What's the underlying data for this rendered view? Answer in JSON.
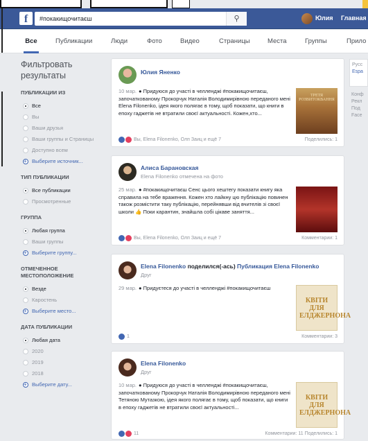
{
  "header": {
    "logo": "f",
    "search_value": "#покакищочитаєш",
    "search_icon": "search-icon",
    "user_name": "Юлия",
    "home_label": "Главная"
  },
  "tabs": [
    "Все",
    "Публикации",
    "Люди",
    "Фото",
    "Видео",
    "Страницы",
    "Места",
    "Группы",
    "Прило"
  ],
  "filters": {
    "title": "Фильтровать результаты",
    "groups": [
      {
        "heading": "ПУБЛИКАЦИИ ИЗ",
        "options": [
          "Все",
          "Вы",
          "Ваши друзья",
          "Ваши группы и Страницы",
          "Доступно всем"
        ],
        "selected": 0,
        "more": "Выберите источник..."
      },
      {
        "heading": "Тип публикации",
        "options": [
          "Все публикации",
          "Просмотренные"
        ],
        "selected": 0,
        "more": ""
      },
      {
        "heading": "ГРУППА",
        "options": [
          "Любая группа",
          "Ваши группы"
        ],
        "selected": 0,
        "more": "Выберите группу..."
      },
      {
        "heading": "ОТМЕЧЕННОЕ МЕСТОПОЛОЖЕНИЕ",
        "options": [
          "Везде",
          "Каростень"
        ],
        "selected": 0,
        "more": "Выберите место..."
      },
      {
        "heading": "ДАТА ПУБЛИКАЦИИ",
        "options": [
          "Любая дата",
          "2020",
          "2019",
          "2018"
        ],
        "selected": 0,
        "more": "Выберите дату..."
      }
    ]
  },
  "posts": [
    {
      "author": "Юлия Яненко",
      "shared": "",
      "shared_target": "",
      "subtitle": "",
      "date": "10 мар.",
      "text": "Придуюся до участі в челленджі #покакищочитаєш, започаткованому Прокорчук Наталія Володимирівною переданого мені Elena Filonenko, ідея якого полягає в тому, щоб показати, що книги в епоху гаджетів не втратили своєї актуальності. Кожен,хто...",
      "reactions": "Вы, Elena Filonenko, Олп Заиц и ещё 7",
      "count": "Поделились: 1",
      "thumb_text": "ТРЕТЯ РОЗВИТОКВАННЯ"
    },
    {
      "author": "Алиса Барановская",
      "shared": "",
      "shared_target": "",
      "subtitle": "Elena Filonenko отмечена на фото",
      "date": "25 мар.",
      "text": "#покакищочитаєш Сенс цього хештегу показати книгу яка справила на тебе враження. Кожен хто лайкну цю публікацію повинен також розмістити таку публікацію, перейнявши від вчителів зі своєї школи 👍 Поки карантин, знайшла собі цікаве заняття...",
      "reactions": "Вы, Elena Filonenko, Олп Заиц и ещё 7",
      "count": "Комментарии: 1",
      "thumb_text": ""
    },
    {
      "author": "Elena Filonenko",
      "shared": "поделился(-ась)",
      "shared_target": "Публикация Elena Filonenko",
      "subtitle": "Друг",
      "date": "29 мар.",
      "text": "Придуєтеся до участі в челленджі #покакищочитаєш",
      "reactions": "1",
      "count": "Комментарии: 3",
      "thumb_text": "КВІТИ ДЛЯ ЕЛДЖЕРНОНА"
    },
    {
      "author": "Elena Filonenko",
      "shared": "",
      "shared_target": "",
      "subtitle": "Друг",
      "date": "10 мар.",
      "text": "Придуюся до участі в челленджі #покакищочитаєш, започаткованому Прокорчук Наталія Володимирівною переданого мені Тетяною Мутазкою, ідея якого полягає в тому, щоб показати, що книги в епоху гаджетів не втратили своєї актуальності...",
      "reactions": "11",
      "count": "Комментарии: 11   Поделились: 1",
      "thumb_text": "КВІТИ ДЛЯ ЕЛДЖЕРНОНА"
    }
  ],
  "right_col": {
    "lines": [
      "Русс",
      "Espa"
    ],
    "lines2": [
      "Конф",
      "Рекл",
      "Под",
      "Face"
    ]
  },
  "colors": {
    "brand": "#3b5998",
    "link": "#365899",
    "accent": "#4267b2"
  }
}
